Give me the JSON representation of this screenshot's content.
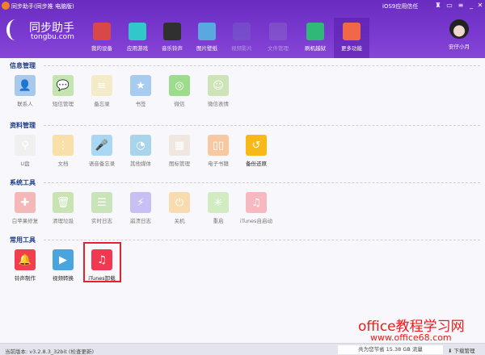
{
  "window": {
    "title": "同步助手(同步推 电脑版)",
    "trust": "iOS9应用信任"
  },
  "brand": {
    "cn": "同步助手",
    "en": "tongbu.com"
  },
  "nav": [
    {
      "label": "我的设备",
      "color": "#d84848"
    },
    {
      "label": "应用游戏",
      "color": "#30c8c8"
    },
    {
      "label": "音乐铃声",
      "color": "#303030"
    },
    {
      "label": "图片壁纸",
      "color": "#5aa8e0"
    },
    {
      "label": "视频影片",
      "color": "#7464c8"
    },
    {
      "label": "文件管理",
      "color": "#8a6cc8"
    },
    {
      "label": "刷机越狱",
      "color": "#30b878"
    },
    {
      "label": "更多功能",
      "color": "#f06848"
    }
  ],
  "user": {
    "name": "安仔小月"
  },
  "sections": [
    {
      "title": "信息管理",
      "items": [
        {
          "label": "联系人",
          "color": "#a8c8ec",
          "glyph": "👤"
        },
        {
          "label": "短信管理",
          "color": "#c4e4b0",
          "glyph": "💬"
        },
        {
          "label": "备忘录",
          "color": "#f4ecc8",
          "glyph": "≡"
        },
        {
          "label": "书签",
          "color": "#a8ccf0",
          "glyph": "★"
        },
        {
          "label": "微信",
          "color": "#9cdc8c",
          "glyph": "◎"
        },
        {
          "label": "微信表情",
          "color": "#cce4b8",
          "glyph": "☺"
        }
      ]
    },
    {
      "title": "资料管理",
      "items": [
        {
          "label": "U盘",
          "color": "#f0f0f0",
          "glyph": "⚲"
        },
        {
          "label": "文档",
          "color": "#f8e0a8",
          "glyph": "⋮"
        },
        {
          "label": "语音备忘录",
          "color": "#a8d8f4",
          "glyph": "🎤"
        },
        {
          "label": "其他媒体",
          "color": "#a8d4ec",
          "glyph": "◔"
        },
        {
          "label": "图标管理",
          "color": "#f0e8e0",
          "glyph": "▦"
        },
        {
          "label": "电子书籍",
          "color": "#f8c8a0",
          "glyph": "▯▯"
        },
        {
          "label": "备份还原",
          "color": "#f8b818",
          "glyph": "↺",
          "dark": true
        }
      ]
    },
    {
      "title": "系统工具",
      "items": [
        {
          "label": "白苹果修复",
          "color": "#f4b8b8",
          "glyph": "✚"
        },
        {
          "label": "清理垃圾",
          "color": "#c8e4b0",
          "glyph": "🗑"
        },
        {
          "label": "实时日志",
          "color": "#c8e4b8",
          "glyph": "☰"
        },
        {
          "label": "崩溃日志",
          "color": "#c8c0f4",
          "glyph": "⚡"
        },
        {
          "label": "关机",
          "color": "#f8dcb0",
          "glyph": "⏻"
        },
        {
          "label": "重启",
          "color": "#d0ecc0",
          "glyph": "✳"
        },
        {
          "label": "iTunes自启动",
          "color": "#f8b8c0",
          "glyph": "♫"
        }
      ]
    },
    {
      "title": "常用工具",
      "items": [
        {
          "label": "铃声制作",
          "color": "#f04050",
          "glyph": "🔔",
          "dark": true
        },
        {
          "label": "视频转换",
          "color": "#4aa4e0",
          "glyph": "▶",
          "dark": true
        },
        {
          "label": "iTunes卸载",
          "color": "#f03850",
          "glyph": "♫",
          "dark": true
        }
      ]
    }
  ],
  "status": {
    "version": "当前版本: v3.2.8.3_32bit  (检查更新)",
    "saved": "共为您节省 15.38 GB 流量",
    "download": "下载管理"
  },
  "watermark": {
    "line1": "office教程学习网",
    "line2": "www.office68.com"
  }
}
